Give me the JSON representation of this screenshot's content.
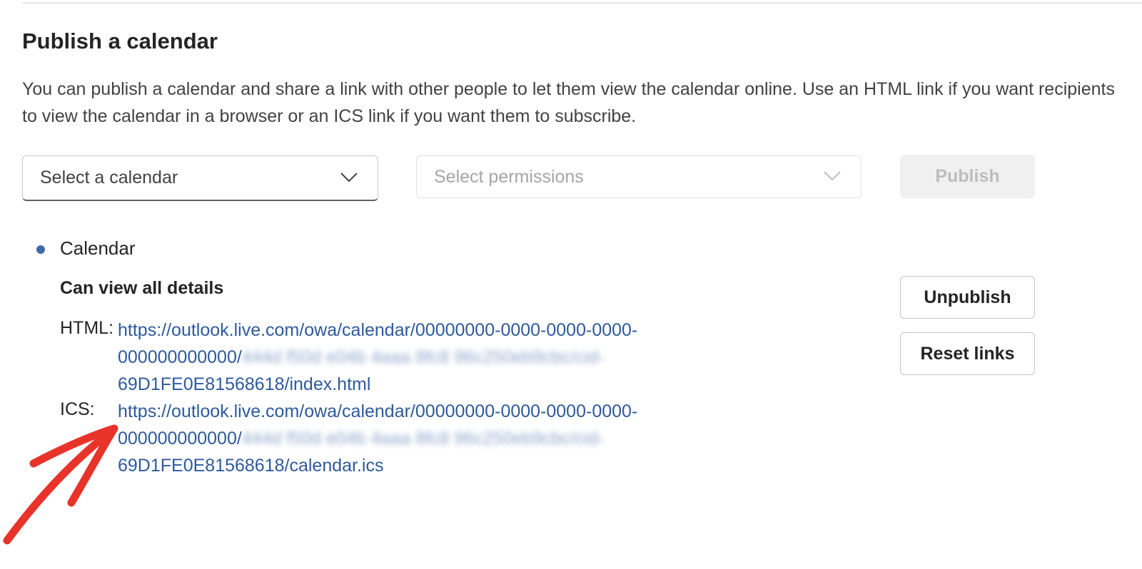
{
  "publish_section": {
    "title": "Publish a calendar",
    "description": "You can publish a calendar and share a link with other people to let them view the calendar online. Use an HTML link if you want recipients to view the calendar in a browser or an ICS link if you want them to subscribe.",
    "calendar_select": {
      "placeholder": "Select a calendar",
      "icon": "chevron-down-icon"
    },
    "permissions_select": {
      "placeholder": "Select permissions",
      "icon": "chevron-down-icon",
      "disabled": true
    },
    "publish_button": {
      "label": "Publish",
      "disabled": true
    }
  },
  "published_calendar": {
    "name": "Calendar",
    "bullet_color": "#3d6aa9",
    "permission": "Can view all details",
    "html": {
      "label": "HTML:",
      "url_lines": [
        "https://outlook.live.com/owa/calendar/00000000-0000-0000-0000-",
        "000000000000/",
        "69D1FE0E81568618/index.html"
      ],
      "blurred_segment": "444d f50d e04b 4aaa 8fc8 96c250eb9cbc/cid-"
    },
    "ics": {
      "label": "ICS:",
      "url_lines": [
        "https://outlook.live.com/owa/calendar/00000000-0000-0000-0000-",
        "000000000000/",
        "69D1FE0E81568618/calendar.ics"
      ],
      "blurred_segment": "444d f50d e04b 4aaa 8fc8 96c250eb9cbc/cid-"
    },
    "unpublish_button": {
      "label": "Unpublish"
    },
    "reset_links_button": {
      "label": "Reset links"
    }
  },
  "annotation": {
    "icon": "red-arrow-icon",
    "color": "#e8332a"
  },
  "colors": {
    "link": "#2e5a9c",
    "text": "#242424",
    "muted": "#424242",
    "disabled_text": "#bdbdbd",
    "disabled_bg": "#f0f0f0"
  }
}
